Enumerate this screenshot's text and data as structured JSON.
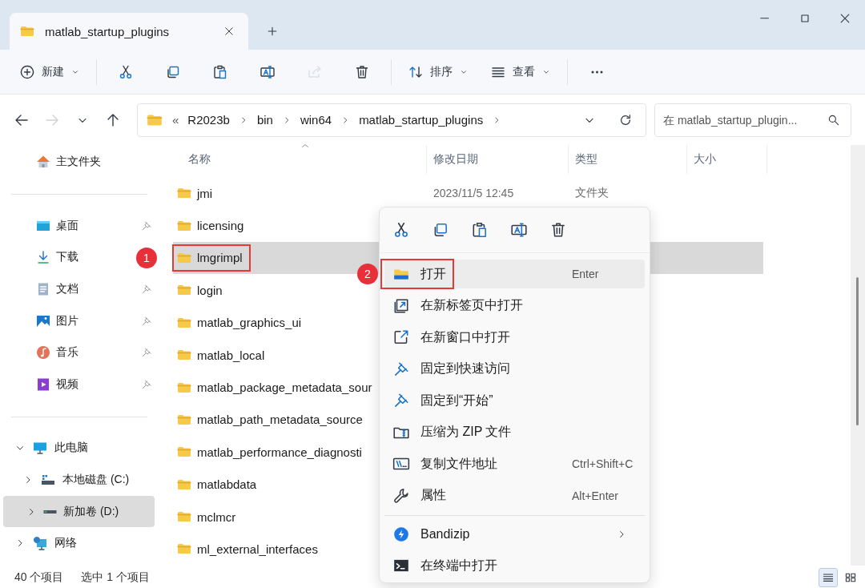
{
  "tab": {
    "title": "matlab_startup_plugins"
  },
  "toolbar": [
    [
      {
        "kind": "new",
        "label": "新建",
        "disabled": false
      }
    ],
    [
      {
        "kind": "cut",
        "disabled": false
      },
      {
        "kind": "copy",
        "disabled": false
      },
      {
        "kind": "paste",
        "disabled": false
      },
      {
        "kind": "rename",
        "disabled": false
      },
      {
        "kind": "share",
        "disabled": true
      },
      {
        "kind": "delete",
        "disabled": false
      }
    ],
    [
      {
        "kind": "sort",
        "label": "排序",
        "disabled": false
      },
      {
        "kind": "view",
        "label": "查看",
        "disabled": false
      }
    ],
    [
      {
        "kind": "more",
        "disabled": false
      }
    ]
  ],
  "nav": [
    {
      "kind": "back",
      "disabled": false
    },
    {
      "kind": "forward",
      "disabled": true
    },
    {
      "kind": "recent",
      "disabled": false
    },
    {
      "kind": "up",
      "disabled": false
    }
  ],
  "address": {
    "overflow": "«",
    "crumbs": [
      "R2023b",
      "bin",
      "win64",
      "matlab_startup_plugins"
    ]
  },
  "search": {
    "placeholder": "在 matlab_startup_plugin..."
  },
  "sidebar": {
    "home": {
      "label": "主文件夹"
    },
    "quick": [
      {
        "kind": "desktop",
        "label": "桌面",
        "pinned": true
      },
      {
        "kind": "download",
        "label": "下载"
      },
      {
        "kind": "docs",
        "label": "文档",
        "pinned": true
      },
      {
        "kind": "pictures",
        "label": "图片",
        "pinned": true
      },
      {
        "kind": "music",
        "label": "音乐",
        "pinned": true
      },
      {
        "kind": "video",
        "label": "视频",
        "pinned": true
      }
    ],
    "tree": [
      {
        "kind": "pc",
        "label": "此电脑",
        "expanded": true,
        "selected": false,
        "children": [
          {
            "kind": "drive-c",
            "label": "本地磁盘 (C:)",
            "expanded": false,
            "selected": false
          },
          {
            "kind": "drive",
            "label": "新加卷 (D:)",
            "expanded": false,
            "selected": true
          }
        ]
      },
      {
        "kind": "network",
        "label": "网络",
        "expanded": false,
        "selected": false
      }
    ]
  },
  "columns": [
    {
      "label": "名称",
      "sorted": true
    },
    {
      "label": "修改日期",
      "sorted": false
    },
    {
      "label": "类型",
      "sorted": false
    },
    {
      "label": "大小",
      "sorted": false
    }
  ],
  "files": [
    {
      "name": "jmi",
      "modified": "2023/11/5 12:45",
      "type": "文件夹",
      "selected": false
    },
    {
      "name": "licensing",
      "selected": false
    },
    {
      "name": "lmgrimpl",
      "selected": true,
      "callout": "1"
    },
    {
      "name": "login",
      "selected": false
    },
    {
      "name": "matlab_graphics_ui",
      "selected": false
    },
    {
      "name": "matlab_local",
      "selected": false
    },
    {
      "name": "matlab_package_metadata_sour",
      "selected": false
    },
    {
      "name": "matlab_path_metadata_source",
      "selected": false
    },
    {
      "name": "matlab_performance_diagnosti",
      "selected": false
    },
    {
      "name": "matlabdata",
      "selected": false
    },
    {
      "name": "mclmcr",
      "selected": false
    },
    {
      "name": "ml_external_interfaces",
      "selected": false
    }
  ],
  "context_menu": {
    "actions": [
      {
        "kind": "cut"
      },
      {
        "kind": "copy"
      },
      {
        "kind": "paste"
      },
      {
        "kind": "rename"
      },
      {
        "kind": "delete"
      }
    ],
    "groups": [
      [
        {
          "kind": "open",
          "label": "打开",
          "shortcut": "Enter",
          "selected": true,
          "callout": "2"
        },
        {
          "kind": "newtab",
          "label": "在新标签页中打开",
          "selected": false
        },
        {
          "kind": "newwindow",
          "label": "在新窗口中打开",
          "selected": false
        },
        {
          "kind": "pin",
          "label": "固定到快速访问",
          "selected": false
        },
        {
          "kind": "pin",
          "label": "固定到“开始”",
          "selected": false
        },
        {
          "kind": "zip",
          "label": "压缩为 ZIP 文件",
          "selected": false
        },
        {
          "kind": "copypath",
          "label": "复制文件地址",
          "shortcut": "Ctrl+Shift+C",
          "selected": false
        },
        {
          "kind": "wrench",
          "label": "属性",
          "shortcut": "Alt+Enter",
          "selected": false
        }
      ],
      [
        {
          "kind": "bandizip",
          "label": "Bandizip",
          "submenu": true,
          "selected": false
        },
        {
          "kind": "terminal",
          "label": "在终端中打开",
          "selected": false
        }
      ]
    ]
  },
  "status": {
    "count": "40 个项目",
    "selection": "选中 1 个项目"
  },
  "view_modes": [
    {
      "kind": "details",
      "selected": true
    },
    {
      "kind": "tiles",
      "selected": false
    }
  ]
}
